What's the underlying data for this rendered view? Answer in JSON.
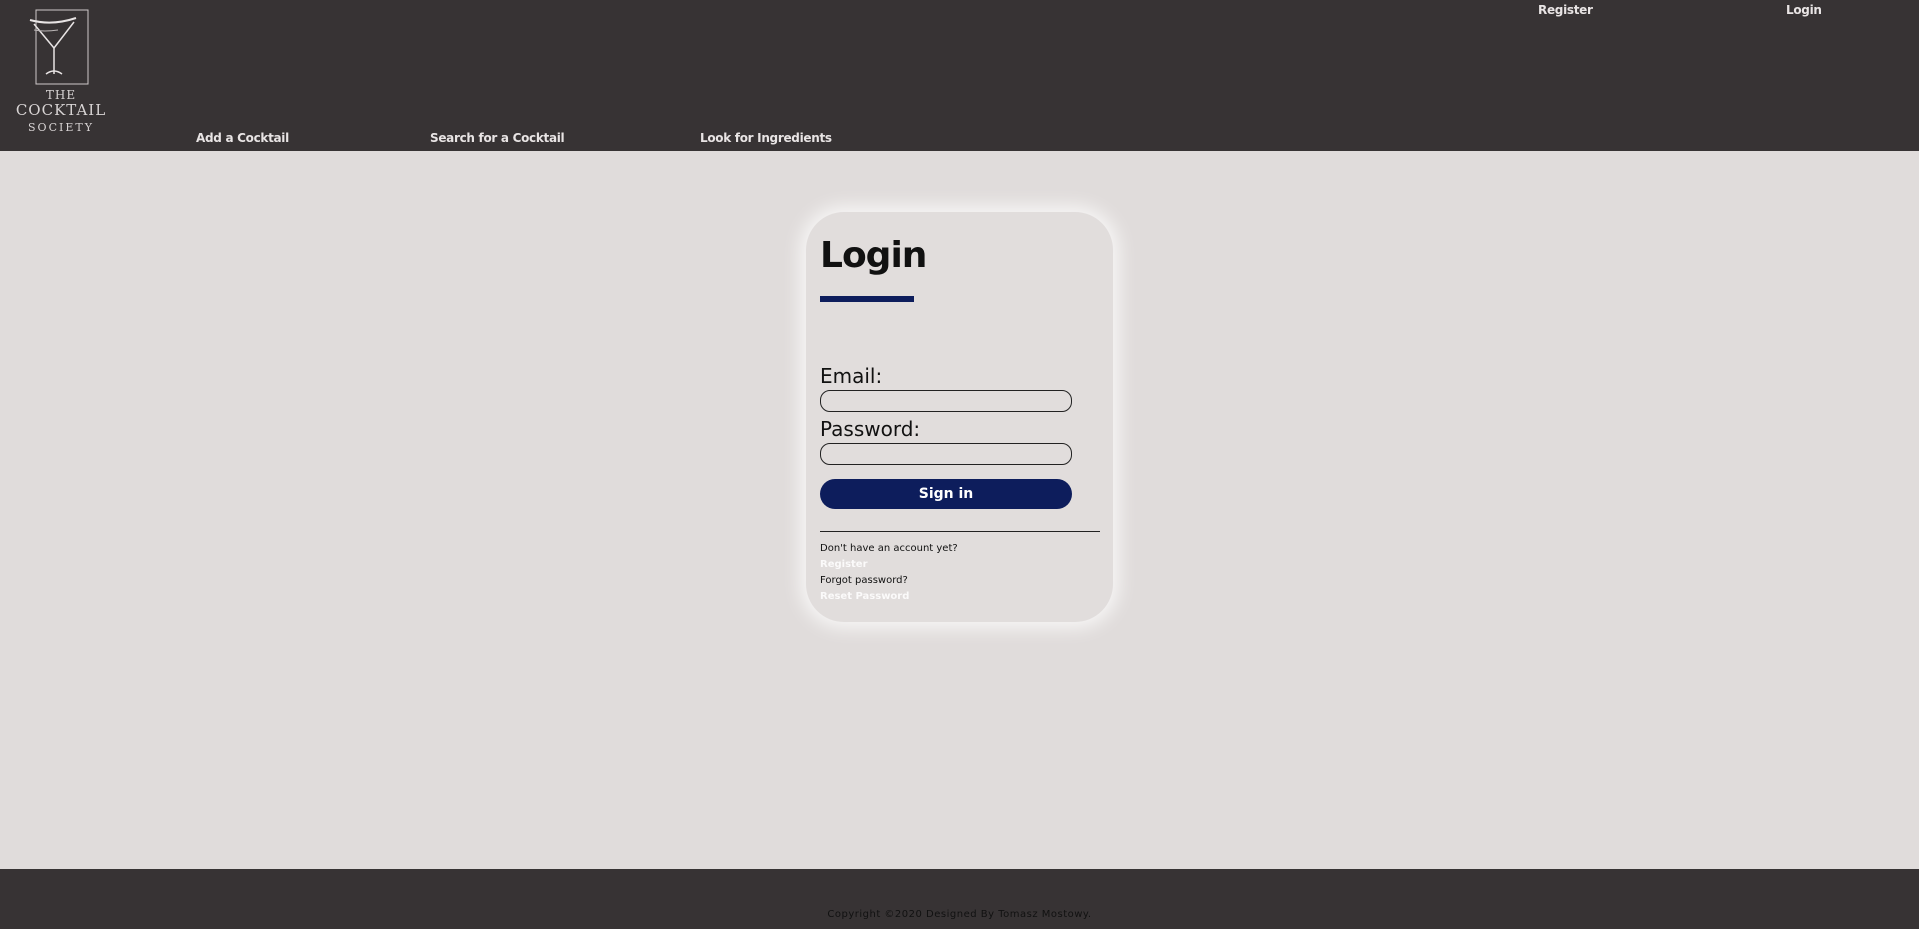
{
  "header": {
    "logo": {
      "line1": "THE",
      "line2": "COCKTAIL",
      "line3": "SOCIETY",
      "icon": "martini-glass-icon"
    },
    "nav": {
      "add_cocktail": "Add a Cocktail",
      "search_cocktail": "Search for a Cocktail",
      "ingredients": "Look for Ingredients"
    },
    "auth": {
      "register": "Register",
      "login": "Login"
    }
  },
  "login_form": {
    "title": "Login",
    "email_label": "Email:",
    "email_value": "",
    "password_label": "Password:",
    "password_value": "",
    "submit_label": "Sign in",
    "no_account_text": "Don't have an account yet?",
    "register_link": "Register",
    "forgot_text": "Forgot password?",
    "reset_link": "Reset Password"
  },
  "footer": {
    "copyright": "Copyright ©2020 Designed By Tomasz Mostowy."
  },
  "colors": {
    "header_bg": "#373334",
    "page_bg": "#e0dcdb",
    "accent": "#0d1d5c",
    "text": "#111111"
  }
}
